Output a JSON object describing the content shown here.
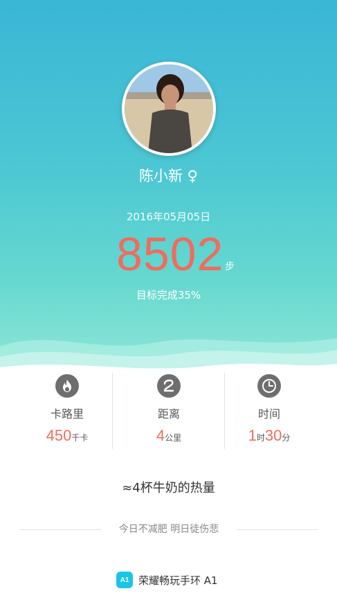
{
  "profile": {
    "name": "陈小新",
    "gender_symbol": "♀"
  },
  "summary": {
    "date": "2016年05月05日",
    "steps": "8502",
    "steps_unit": "步",
    "goal_text": "目标完成35%"
  },
  "stats": [
    {
      "icon": "flame-icon",
      "label": "卡路里",
      "value": "450",
      "unit": "千卡"
    },
    {
      "icon": "distance-icon",
      "label": "距离",
      "value": "4",
      "unit": "公里"
    },
    {
      "icon": "clock-icon",
      "label": "时间",
      "value_hours": "1",
      "unit_hours": "时",
      "value_minutes": "30",
      "unit_minutes": "分"
    }
  ],
  "milk_text": "≈4杯牛奶的热量",
  "slogan": "今日不减肥  明日徒伤悲",
  "device": {
    "icon_text": "A1",
    "name": "荣耀畅玩手环 A1"
  },
  "colors": {
    "accent": "#f26b5b",
    "top_gradient": "#3ab6d6",
    "wave": "#8fe6d8"
  }
}
